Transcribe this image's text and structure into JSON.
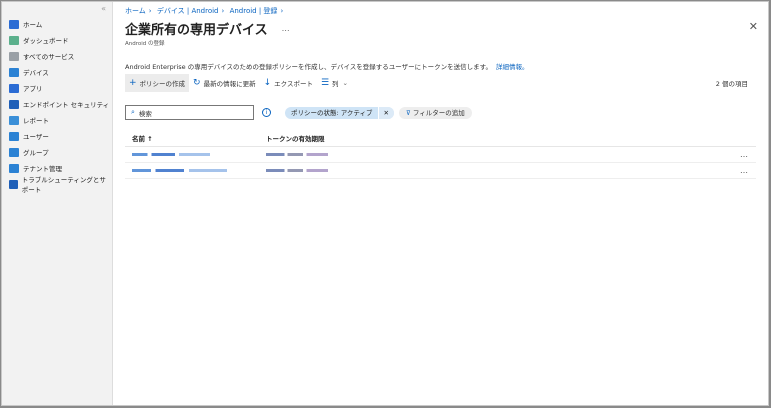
{
  "sidebar": {
    "collapse": "«",
    "items": [
      {
        "label": "ホーム",
        "color": "#2b6cd4"
      },
      {
        "label": "ダッシュボード",
        "color": "#5bb08c"
      },
      {
        "label": "すべてのサービス",
        "color": "#9aa0a6"
      },
      {
        "label": "デバイス",
        "color": "#2b82d4"
      },
      {
        "label": "アプリ",
        "color": "#2b6cd4"
      },
      {
        "label": "エンドポイント セキュリティ",
        "color": "#1f5fb8"
      },
      {
        "label": "レポート",
        "color": "#3a8fd8"
      },
      {
        "label": "ユーザー",
        "color": "#2b82d4"
      },
      {
        "label": "グループ",
        "color": "#2b82d4"
      },
      {
        "label": "テナント管理",
        "color": "#2b82d4"
      },
      {
        "label": "トラブルシューティングとサポート",
        "color": "#1f5fb8"
      }
    ]
  },
  "breadcrumb": [
    "ホーム",
    "›",
    "デバイス | Android",
    "›",
    "Android | 登録",
    "›"
  ],
  "header": {
    "title": "企業所有の専用デバイス",
    "more": "…",
    "subtitle": "Android の登録",
    "close": "✕"
  },
  "description": {
    "text": "Android Enterprise の専用デバイスのための登録ポリシーを作成し、デバイスを登録するユーザーにトークンを送信します。",
    "link": "詳細情報。"
  },
  "toolbar": {
    "create": "ポリシーの作成",
    "refresh": "最新の情報に更新",
    "export": "エクスポート",
    "columns": "列",
    "count": "2 個の項目"
  },
  "filters": {
    "search_placeholder": "検索",
    "info": "i",
    "pill": "ポリシーの状態: アクティブ",
    "pill_remove": "✕",
    "add_filter": "フィルターの追加"
  },
  "table": {
    "headers": [
      "名前 ↑",
      "トークンの有効期限"
    ],
    "row_more": "…"
  }
}
